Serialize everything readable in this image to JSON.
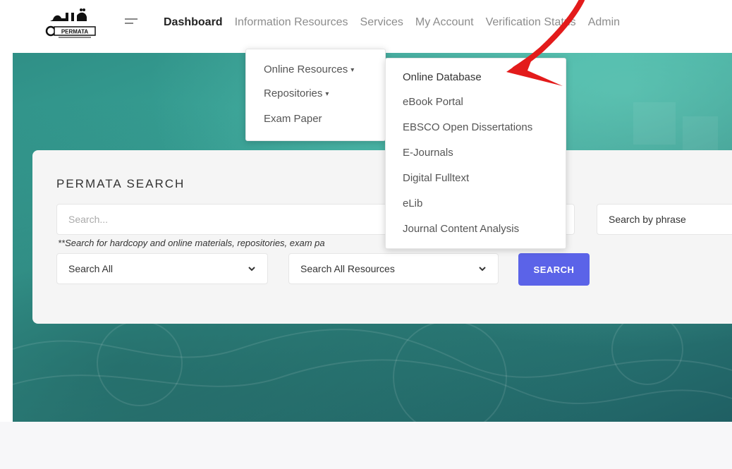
{
  "navbar": {
    "logo_text": "PERMATA",
    "items": [
      {
        "label": "Dashboard",
        "active": true
      },
      {
        "label": "Information Resources",
        "active": false
      },
      {
        "label": "Services",
        "active": false
      },
      {
        "label": "My Account",
        "active": false
      },
      {
        "label": "Verification Status",
        "active": false
      },
      {
        "label": "Admin",
        "active": false
      }
    ]
  },
  "dropdown_main": {
    "items": [
      {
        "label": "Online Resources",
        "has_submenu": true
      },
      {
        "label": "Repositories",
        "has_submenu": true
      },
      {
        "label": "Exam Paper",
        "has_submenu": false
      }
    ]
  },
  "dropdown_sub": {
    "items": [
      {
        "label": "Online Database",
        "highlighted": true
      },
      {
        "label": "eBook Portal"
      },
      {
        "label": "EBSCO Open Dissertations"
      },
      {
        "label": "E-Journals"
      },
      {
        "label": "Digital Fulltext"
      },
      {
        "label": "eLib"
      },
      {
        "label": "Journal Content Analysis"
      }
    ]
  },
  "search": {
    "title": "PERMATA SEARCH",
    "placeholder": "Search...",
    "hint": "**Search for hardcopy and online materials, repositories, exam pa",
    "phrase_select": "Search by phrase",
    "scope_select": "Search All",
    "resource_select": "Search All Resources",
    "button_label": "SEARCH"
  },
  "colors": {
    "accent": "#5b63e8",
    "annotation": "#e31b1b",
    "hero": "#2f8f86"
  },
  "icons": {
    "menu": "hamburger-icon",
    "chevron": "chevron-down-icon",
    "annotation": "red-arrow-annotation"
  }
}
